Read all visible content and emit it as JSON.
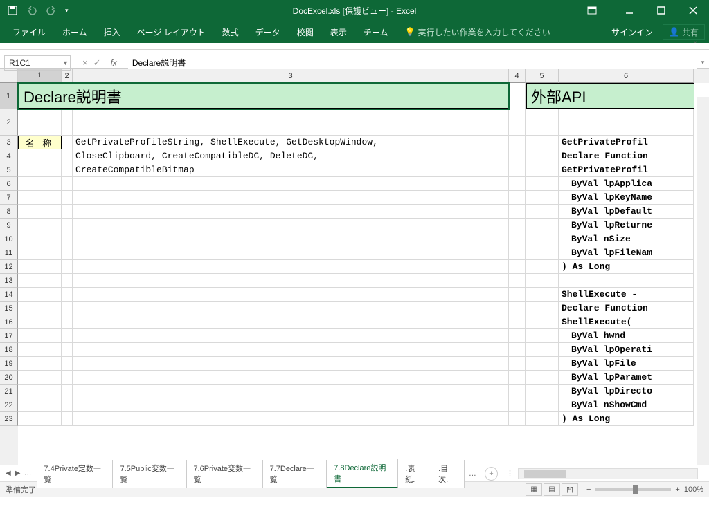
{
  "window": {
    "title": "DocExcel.xls  [保護ビュー] - Excel"
  },
  "ribbon": {
    "tabs": [
      "ファイル",
      "ホーム",
      "挿入",
      "ページ レイアウト",
      "数式",
      "データ",
      "校閲",
      "表示",
      "チーム"
    ],
    "tell_me": "実行したい作業を入力してください",
    "sign_in": "サインイン",
    "share": "共有"
  },
  "formula_bar": {
    "name_box": "R1C1",
    "formula": "Declare説明書"
  },
  "columns": [
    {
      "n": "1",
      "w": "w1"
    },
    {
      "n": "2",
      "w": "w2"
    },
    {
      "n": "3",
      "w": "w3"
    },
    {
      "n": "4",
      "w": "w4"
    },
    {
      "n": "5",
      "w": "w5"
    },
    {
      "n": "6",
      "w": "w6"
    }
  ],
  "cells": {
    "title_left": "Declare説明書",
    "title_right": "外部API",
    "label_r3c1": "名 称",
    "r3c3": "GetPrivateProfileString, ShellExecute, GetDesktopWindow,",
    "r4c3": "CloseClipboard, CreateCompatibleDC, DeleteDC,",
    "r5c3": "CreateCompatibleBitmap",
    "right_col": {
      "r3": "GetPrivateProfil",
      "r4": "Declare Function",
      "r5": "GetPrivateProfil",
      "r6": "ByVal lpApplica",
      "r7": "ByVal lpKeyName",
      "r8": "ByVal lpDefault",
      "r9": "ByVal lpReturne",
      "r10": "ByVal nSize",
      "r11": "ByVal lpFileNam",
      "r12": ") As Long",
      "r14": "ShellExecute - ",
      "r15": "Declare Function",
      "r16": "ShellExecute(",
      "r17": "ByVal hwnd",
      "r18": "ByVal lpOperati",
      "r19": "ByVal lpFile",
      "r20": "ByVal lpParamet",
      "r21": "ByVal lpDirecto",
      "r22": "ByVal nShowCmd",
      "r23": ") As Long"
    }
  },
  "sheet_tabs": {
    "items": [
      "7.4Private定数一覧",
      "7.5Public変数一覧",
      "7.6Private変数一覧",
      "7.7Declare一覧",
      "7.8Declare説明書",
      ".表紙.",
      ".目次."
    ],
    "active_index": 4
  },
  "status": {
    "ready": "準備完了",
    "zoom": "100%"
  }
}
